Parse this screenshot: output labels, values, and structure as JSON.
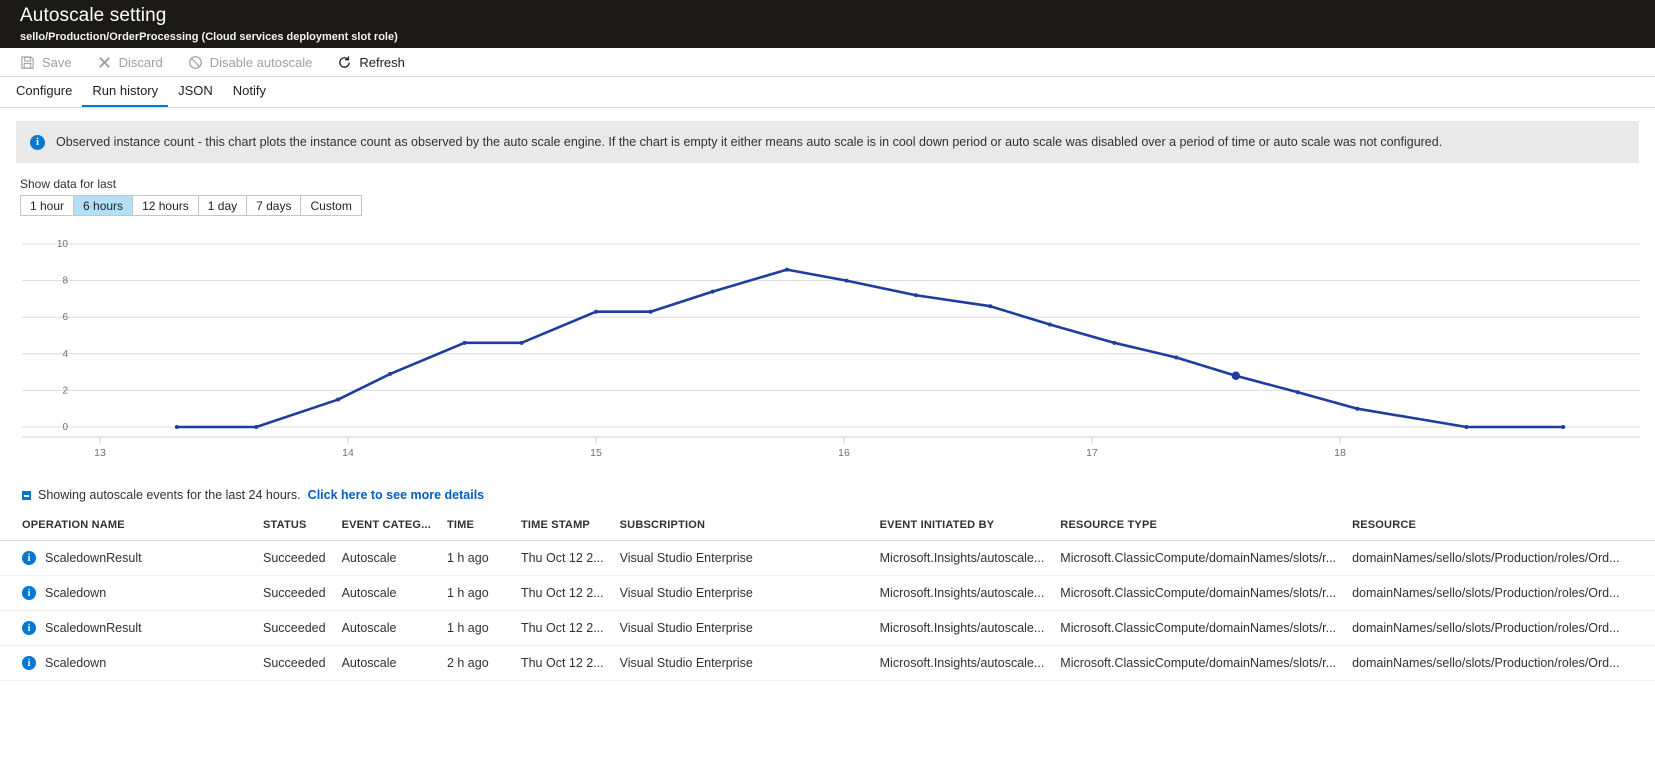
{
  "header": {
    "title": "Autoscale setting",
    "subtitle": "sello/Production/OrderProcessing (Cloud services deployment slot role)"
  },
  "command_bar": {
    "items": [
      {
        "label": "Save",
        "icon": "save-icon",
        "enabled": false
      },
      {
        "label": "Discard",
        "icon": "discard-icon",
        "enabled": false
      },
      {
        "label": "Disable autoscale",
        "icon": "disable-icon",
        "enabled": false
      },
      {
        "label": "Refresh",
        "icon": "refresh-icon",
        "enabled": true
      }
    ]
  },
  "tabs": [
    {
      "label": "Configure",
      "active": false
    },
    {
      "label": "Run history",
      "active": true
    },
    {
      "label": "JSON",
      "active": false
    },
    {
      "label": "Notify",
      "active": false
    }
  ],
  "banner": {
    "icon": "info-icon",
    "text": "Observed instance count - this chart plots the instance count as observed by the auto scale engine. If the chart is empty it either means auto scale is in cool down period or auto scale was disabled over a period of time or auto scale was not configured."
  },
  "time_range": {
    "label": "Show data for last",
    "options": [
      "1 hour",
      "6 hours",
      "12 hours",
      "1 day",
      "7 days",
      "Custom"
    ],
    "selected": "6 hours"
  },
  "chart_data": {
    "type": "line",
    "title": "",
    "xlabel": "",
    "ylabel": "",
    "ylim": [
      0,
      10
    ],
    "yticks": [
      0,
      2,
      4,
      6,
      8,
      10
    ],
    "xticks": [
      "13",
      "14",
      "15",
      "16",
      "17",
      "18"
    ],
    "grid": true,
    "legend": null,
    "line_color": "#1f3c9e",
    "series": [
      {
        "name": "Observed instance count",
        "x": [
          13.31,
          13.63,
          13.96,
          14.17,
          14.47,
          14.7,
          15.0,
          15.22,
          15.47,
          15.77,
          16.01,
          16.29,
          16.59,
          16.83,
          17.09,
          17.34,
          17.58,
          17.83,
          18.07,
          18.51,
          18.9
        ],
        "values": [
          0,
          0,
          1.5,
          2.9,
          4.6,
          4.6,
          6.3,
          6.3,
          7.4,
          8.6,
          8.0,
          7.2,
          6.6,
          5.6,
          4.6,
          3.8,
          2.8,
          1.9,
          1.0,
          0,
          0
        ]
      }
    ],
    "highlighted_point": {
      "x": 17.58,
      "y": 2.8
    }
  },
  "events_note": {
    "text": "Showing autoscale events for the last 24 hours.",
    "link": "Click here to see more details"
  },
  "events_table": {
    "columns": [
      "OPERATION NAME",
      "STATUS",
      "EVENT CATEG...",
      "TIME",
      "TIME STAMP",
      "SUBSCRIPTION",
      "EVENT INITIATED BY",
      "RESOURCE TYPE",
      "RESOURCE"
    ],
    "rows": [
      {
        "operation": "ScaledownResult",
        "status": "Succeeded",
        "category": "Autoscale",
        "time": "1 h ago",
        "timestamp": "Thu Oct 12 2...",
        "subscription": "Visual Studio Enterprise",
        "initiated_by": "Microsoft.Insights/autoscale...",
        "resource_type": "Microsoft.ClassicCompute/domainNames/slots/r...",
        "resource": "domainNames/sello/slots/Production/roles/Ord..."
      },
      {
        "operation": "Scaledown",
        "status": "Succeeded",
        "category": "Autoscale",
        "time": "1 h ago",
        "timestamp": "Thu Oct 12 2...",
        "subscription": "Visual Studio Enterprise",
        "initiated_by": "Microsoft.Insights/autoscale...",
        "resource_type": "Microsoft.ClassicCompute/domainNames/slots/r...",
        "resource": "domainNames/sello/slots/Production/roles/Ord..."
      },
      {
        "operation": "ScaledownResult",
        "status": "Succeeded",
        "category": "Autoscale",
        "time": "1 h ago",
        "timestamp": "Thu Oct 12 2...",
        "subscription": "Visual Studio Enterprise",
        "initiated_by": "Microsoft.Insights/autoscale...",
        "resource_type": "Microsoft.ClassicCompute/domainNames/slots/r...",
        "resource": "domainNames/sello/slots/Production/roles/Ord..."
      },
      {
        "operation": "Scaledown",
        "status": "Succeeded",
        "category": "Autoscale",
        "time": "2 h ago",
        "timestamp": "Thu Oct 12 2...",
        "subscription": "Visual Studio Enterprise",
        "initiated_by": "Microsoft.Insights/autoscale...",
        "resource_type": "Microsoft.ClassicCompute/domainNames/slots/r...",
        "resource": "domainNames/sello/slots/Production/roles/Ord..."
      }
    ]
  },
  "colors": {
    "accent": "#0078d4",
    "link": "#0060c0",
    "chart_line": "#1f3c9e",
    "header_bg": "#1b1a19",
    "banner_bg": "#e9e9e9",
    "selected_range_bg": "#b3e0f7"
  }
}
